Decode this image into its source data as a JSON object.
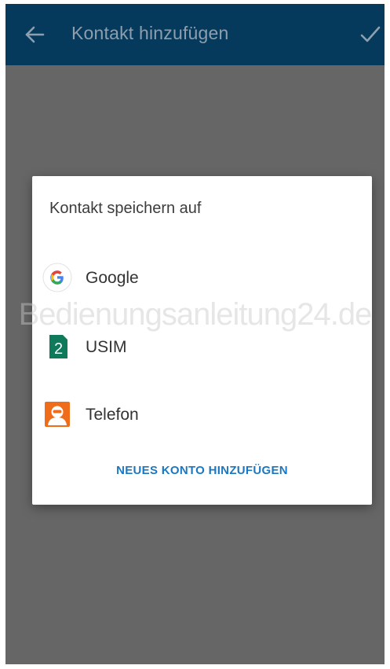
{
  "app_bar": {
    "title": "Kontakt hinzufügen",
    "back_icon": "arrow-left-icon",
    "confirm_icon": "check-icon",
    "background": "#053a5c"
  },
  "dialog": {
    "title": "Kontakt speichern auf",
    "options": [
      {
        "label": "Google",
        "icon": "google-icon"
      },
      {
        "label": "USIM",
        "icon": "sim-2-icon"
      },
      {
        "label": "Telefon",
        "icon": "phone-contact-icon"
      }
    ],
    "add_account_label": "NEUES KONTO HINZUFÜGEN",
    "accent_color": "#1a78c2"
  },
  "watermark": "Bedienungsanleitung24.de",
  "colors": {
    "scrim": "#666666",
    "usim_green": "#0f7a5a",
    "telefon_orange": "#ef6c1a"
  }
}
